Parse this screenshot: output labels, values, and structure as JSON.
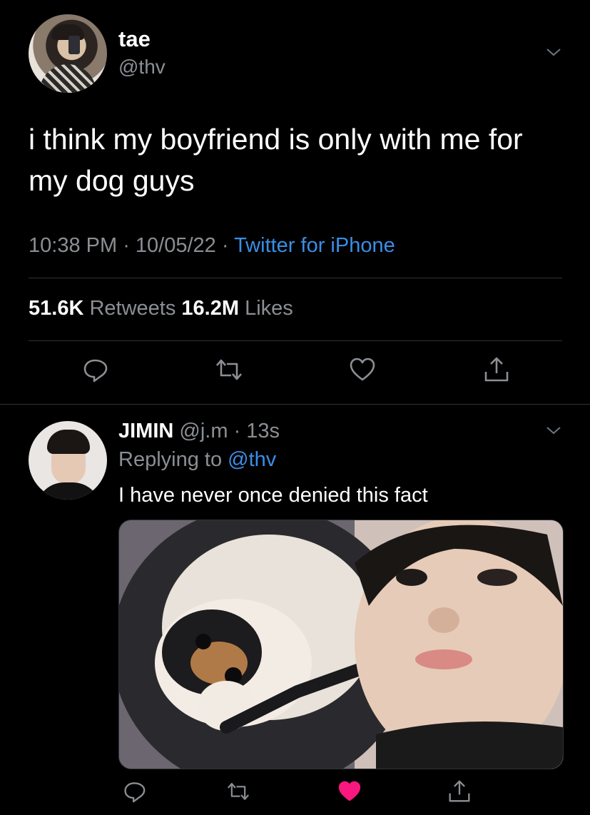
{
  "tweet": {
    "author_name": "tae",
    "author_handle": "@thv",
    "text": "i think my boyfriend is only with me for\nmy dog guys",
    "time": "10:38 PM",
    "date": "10/05/22",
    "source": "Twitter for iPhone",
    "separator": " · ",
    "retweets_count": "51.6K",
    "retweets_label": " Retweets",
    "likes_count": "16.2M",
    "likes_label": " Likes"
  },
  "reply": {
    "author_name": "JIMIN",
    "author_handle": "@j.m",
    "separator": " · ",
    "time_ago": "13s",
    "replying_to_label": "Replying to ",
    "replying_to_handle": "@thv",
    "text": "I have never once denied this fact",
    "liked": true
  },
  "icons": {
    "chevron": "chevron-down-icon",
    "reply": "reply-icon",
    "retweet": "retweet-icon",
    "like": "heart-icon",
    "share": "share-icon"
  },
  "colors": {
    "background": "#000000",
    "text_primary": "#ffffff",
    "text_secondary": "#8b8f94",
    "link": "#3a8ee6",
    "like_active": "#f91880",
    "divider": "#2f3336"
  }
}
